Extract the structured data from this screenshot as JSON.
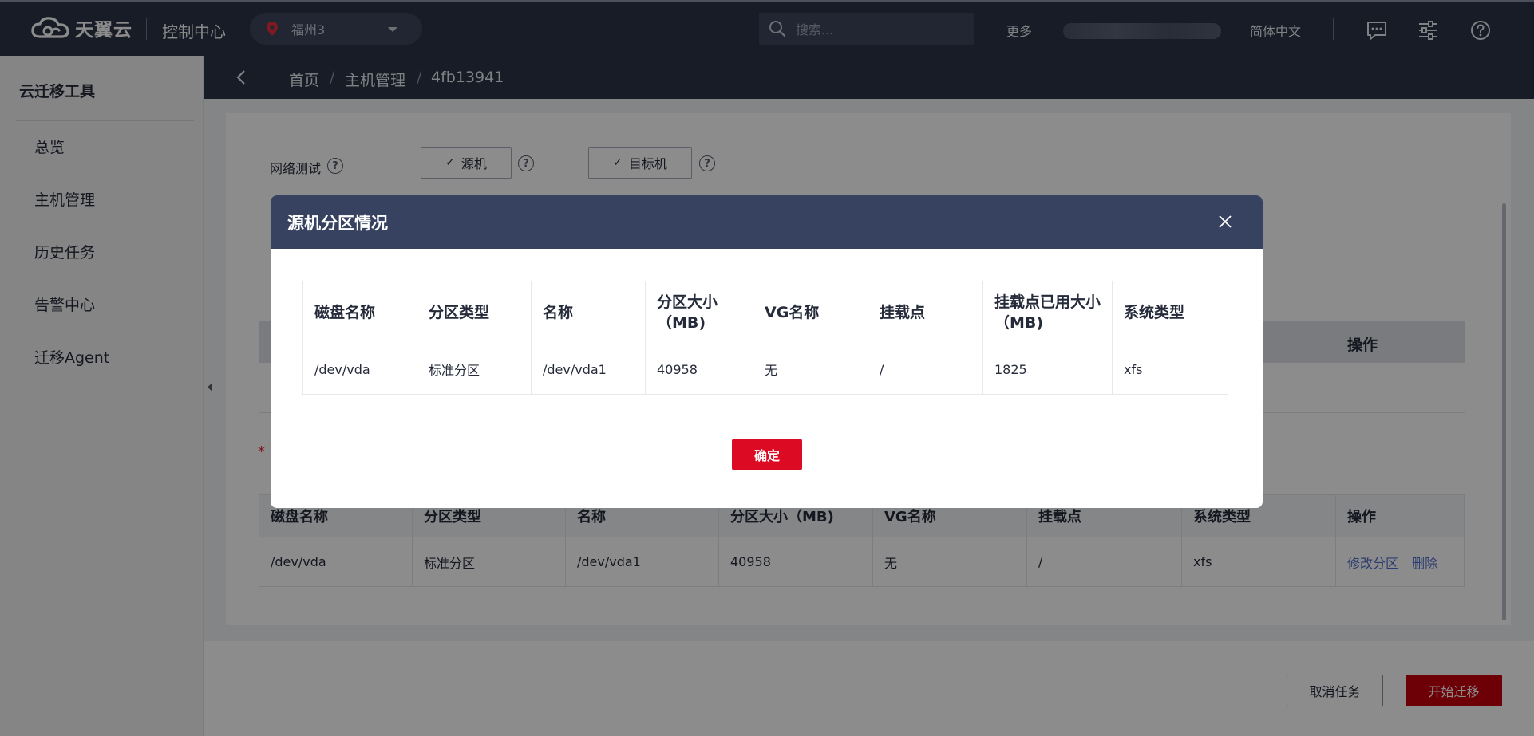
{
  "header": {
    "brand": "天翼云",
    "console": "控制中心",
    "region": "福州3",
    "search_placeholder": "搜索...",
    "more": "更多",
    "language": "简体中文"
  },
  "sidebar": {
    "title": "云迁移工具",
    "items": [
      {
        "label": "总览"
      },
      {
        "label": "主机管理"
      },
      {
        "label": "历史任务"
      },
      {
        "label": "告警中心"
      },
      {
        "label": "迁移Agent"
      }
    ]
  },
  "breadcrumb": {
    "home": "首页",
    "sep": "/",
    "section": "主机管理",
    "current": "4fb13941"
  },
  "network_test": {
    "label": "网络测试",
    "source_btn": "源机",
    "target_btn": "目标机",
    "check": "✓"
  },
  "background_table": {
    "ops_header": "操作",
    "required_mark": "*",
    "headers": [
      "磁盘名称",
      "分区类型",
      "名称",
      "分区大小（MB)",
      "VG名称",
      "挂载点",
      "系统类型",
      "操作"
    ],
    "row": [
      "/dev/vda",
      "标准分区",
      "/dev/vda1",
      "40958",
      "无",
      "/",
      "xfs"
    ],
    "actions": [
      "修改分区",
      "删除"
    ]
  },
  "footer": {
    "cancel": "取消任务",
    "start": "开始迁移"
  },
  "modal": {
    "title": "源机分区情况",
    "headers": [
      "磁盘名称",
      "分区类型",
      "名称",
      "分区大小（MB)",
      "VG名称",
      "挂载点",
      "挂载点已用大小（MB)",
      "系统类型"
    ],
    "row": [
      "/dev/vda",
      "标准分区",
      "/dev/vda1",
      "40958",
      "无",
      "/",
      "1825",
      "xfs"
    ],
    "confirm": "确定"
  },
  "colors": {
    "topbar": "#2b3345",
    "modal_header": "#374260",
    "primary_red": "#c7000b",
    "confirm_red": "#dc0a23",
    "link_blue": "#526ecc"
  }
}
